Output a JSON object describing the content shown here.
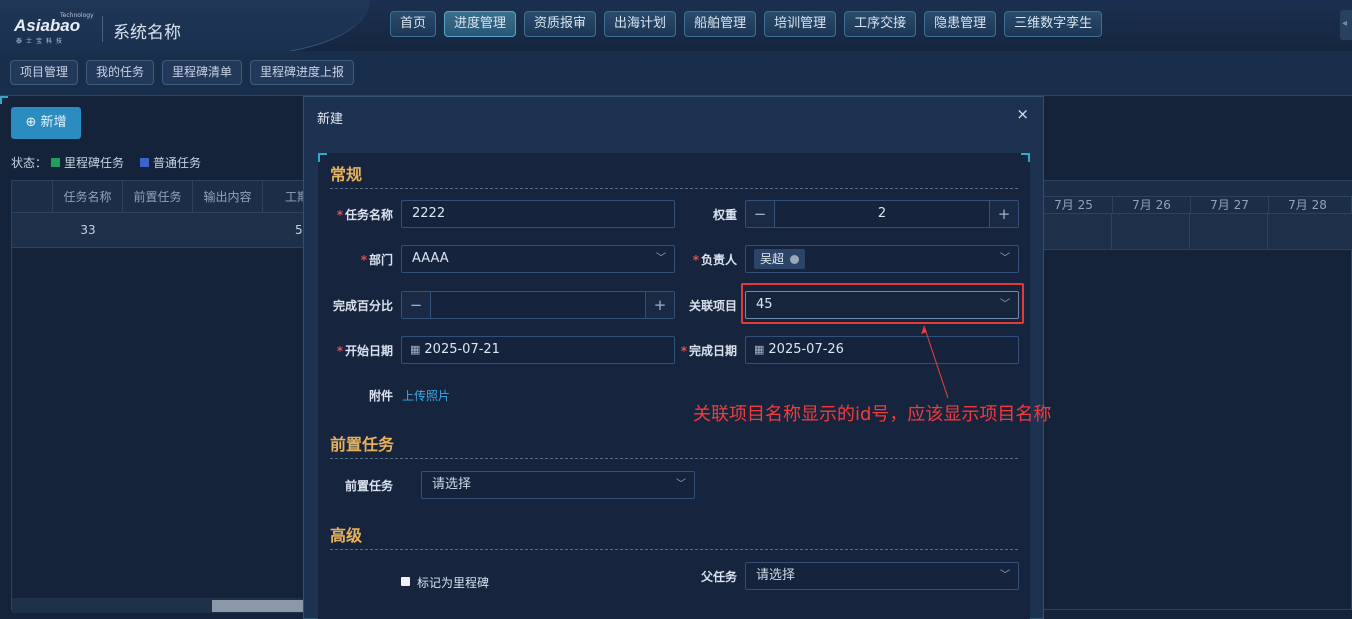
{
  "header": {
    "logo_text": "Asiabao",
    "logo_tagline": "Technology",
    "logo_sub": "泰士宝科技",
    "system_name": "系统名称",
    "nav": [
      {
        "label": "首页",
        "active": false
      },
      {
        "label": "进度管理",
        "active": true
      },
      {
        "label": "资质报审",
        "active": false
      },
      {
        "label": "出海计划",
        "active": false
      },
      {
        "label": "船舶管理",
        "active": false
      },
      {
        "label": "培训管理",
        "active": false
      },
      {
        "label": "工序交接",
        "active": false
      },
      {
        "label": "隐患管理",
        "active": false
      },
      {
        "label": "三维数字孪生",
        "active": false
      }
    ]
  },
  "subnav": [
    "项目管理",
    "我的任务",
    "里程碑清单",
    "里程碑进度上报"
  ],
  "toolbar": {
    "add_label": "新增",
    "add_icon": "plus-circle-icon"
  },
  "status_legend": {
    "label": "状态：",
    "items": [
      {
        "label": "里程碑任务",
        "color": "#1e9e5a"
      },
      {
        "label": "普通任务",
        "color": "#3b63c9"
      }
    ]
  },
  "grid": {
    "columns": [
      "任务名称",
      "前置任务",
      "输出内容",
      "工期"
    ],
    "row": {
      "name": "33",
      "duration": "5"
    },
    "date_columns": [
      "7月 25",
      "7月 26",
      "7月 27",
      "7月 28"
    ]
  },
  "modal": {
    "title": "新建",
    "close": "×",
    "sections": {
      "general": "常规",
      "predecessor": "前置任务",
      "advanced": "高级"
    },
    "fields": {
      "task_name": {
        "label": "任务名称",
        "value": "2222",
        "required": true
      },
      "weight": {
        "label": "权重",
        "value": "2",
        "minus": "−",
        "plus": "+"
      },
      "department": {
        "label": "部门",
        "value": "AAAA",
        "required": true
      },
      "owner": {
        "label": "负责人",
        "tag": "吴超",
        "required": true
      },
      "percent_done": {
        "label": "完成百分比",
        "value": "",
        "minus": "−",
        "plus": "+"
      },
      "related_project": {
        "label": "关联项目",
        "value": "45"
      },
      "start_date": {
        "label": "开始日期",
        "value": "2025-07-21",
        "required": true
      },
      "end_date": {
        "label": "完成日期",
        "value": "2025-07-26",
        "required": true
      },
      "attachment": {
        "label": "附件",
        "link": "上传照片"
      },
      "predecessor": {
        "label": "前置任务",
        "placeholder": "请选择"
      },
      "milestone": {
        "label": "标记为里程碑",
        "checked": false
      },
      "parent_task": {
        "label": "父任务",
        "placeholder": "请选择"
      }
    }
  },
  "annotation": {
    "text": "关联项目名称显示的id号，应该显示项目名称",
    "color": "#f23c3c"
  }
}
